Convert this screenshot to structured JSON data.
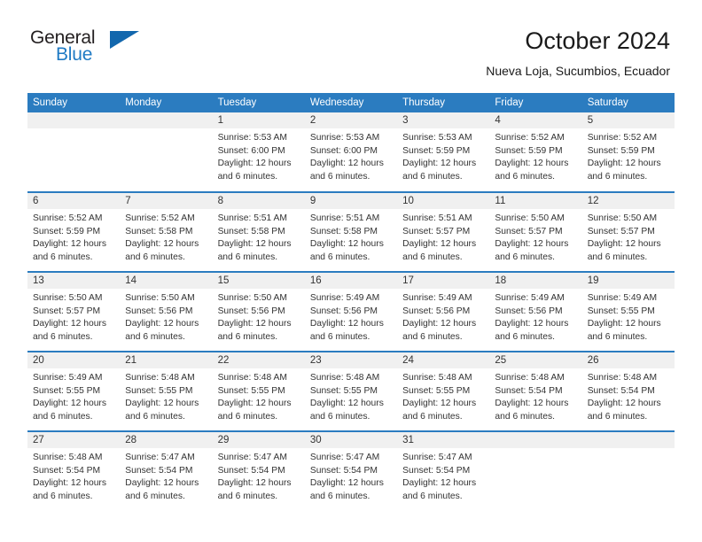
{
  "brand": {
    "name_top": "General",
    "name_bottom": "Blue",
    "accent_color": "#1267ad",
    "text_color": "#231f20"
  },
  "header": {
    "title": "October 2024",
    "subtitle": "Nueva Loja, Sucumbios, Ecuador",
    "header_bg": "#2b7cc0",
    "header_text": "#ffffff"
  },
  "weekdays": [
    "Sunday",
    "Monday",
    "Tuesday",
    "Wednesday",
    "Thursday",
    "Friday",
    "Saturday"
  ],
  "labels": {
    "sunrise_prefix": "Sunrise: ",
    "sunset_prefix": "Sunset: ",
    "daylight_prefix": "Daylight: "
  },
  "weeks": [
    [
      {
        "day": "",
        "sunrise": "",
        "sunset": "",
        "daylight_line1": "",
        "daylight_line2": ""
      },
      {
        "day": "",
        "sunrise": "",
        "sunset": "",
        "daylight_line1": "",
        "daylight_line2": ""
      },
      {
        "day": "1",
        "sunrise": "Sunrise: 5:53 AM",
        "sunset": "Sunset: 6:00 PM",
        "daylight_line1": "Daylight: 12 hours",
        "daylight_line2": "and 6 minutes."
      },
      {
        "day": "2",
        "sunrise": "Sunrise: 5:53 AM",
        "sunset": "Sunset: 6:00 PM",
        "daylight_line1": "Daylight: 12 hours",
        "daylight_line2": "and 6 minutes."
      },
      {
        "day": "3",
        "sunrise": "Sunrise: 5:53 AM",
        "sunset": "Sunset: 5:59 PM",
        "daylight_line1": "Daylight: 12 hours",
        "daylight_line2": "and 6 minutes."
      },
      {
        "day": "4",
        "sunrise": "Sunrise: 5:52 AM",
        "sunset": "Sunset: 5:59 PM",
        "daylight_line1": "Daylight: 12 hours",
        "daylight_line2": "and 6 minutes."
      },
      {
        "day": "5",
        "sunrise": "Sunrise: 5:52 AM",
        "sunset": "Sunset: 5:59 PM",
        "daylight_line1": "Daylight: 12 hours",
        "daylight_line2": "and 6 minutes."
      }
    ],
    [
      {
        "day": "6",
        "sunrise": "Sunrise: 5:52 AM",
        "sunset": "Sunset: 5:59 PM",
        "daylight_line1": "Daylight: 12 hours",
        "daylight_line2": "and 6 minutes."
      },
      {
        "day": "7",
        "sunrise": "Sunrise: 5:52 AM",
        "sunset": "Sunset: 5:58 PM",
        "daylight_line1": "Daylight: 12 hours",
        "daylight_line2": "and 6 minutes."
      },
      {
        "day": "8",
        "sunrise": "Sunrise: 5:51 AM",
        "sunset": "Sunset: 5:58 PM",
        "daylight_line1": "Daylight: 12 hours",
        "daylight_line2": "and 6 minutes."
      },
      {
        "day": "9",
        "sunrise": "Sunrise: 5:51 AM",
        "sunset": "Sunset: 5:58 PM",
        "daylight_line1": "Daylight: 12 hours",
        "daylight_line2": "and 6 minutes."
      },
      {
        "day": "10",
        "sunrise": "Sunrise: 5:51 AM",
        "sunset": "Sunset: 5:57 PM",
        "daylight_line1": "Daylight: 12 hours",
        "daylight_line2": "and 6 minutes."
      },
      {
        "day": "11",
        "sunrise": "Sunrise: 5:50 AM",
        "sunset": "Sunset: 5:57 PM",
        "daylight_line1": "Daylight: 12 hours",
        "daylight_line2": "and 6 minutes."
      },
      {
        "day": "12",
        "sunrise": "Sunrise: 5:50 AM",
        "sunset": "Sunset: 5:57 PM",
        "daylight_line1": "Daylight: 12 hours",
        "daylight_line2": "and 6 minutes."
      }
    ],
    [
      {
        "day": "13",
        "sunrise": "Sunrise: 5:50 AM",
        "sunset": "Sunset: 5:57 PM",
        "daylight_line1": "Daylight: 12 hours",
        "daylight_line2": "and 6 minutes."
      },
      {
        "day": "14",
        "sunrise": "Sunrise: 5:50 AM",
        "sunset": "Sunset: 5:56 PM",
        "daylight_line1": "Daylight: 12 hours",
        "daylight_line2": "and 6 minutes."
      },
      {
        "day": "15",
        "sunrise": "Sunrise: 5:50 AM",
        "sunset": "Sunset: 5:56 PM",
        "daylight_line1": "Daylight: 12 hours",
        "daylight_line2": "and 6 minutes."
      },
      {
        "day": "16",
        "sunrise": "Sunrise: 5:49 AM",
        "sunset": "Sunset: 5:56 PM",
        "daylight_line1": "Daylight: 12 hours",
        "daylight_line2": "and 6 minutes."
      },
      {
        "day": "17",
        "sunrise": "Sunrise: 5:49 AM",
        "sunset": "Sunset: 5:56 PM",
        "daylight_line1": "Daylight: 12 hours",
        "daylight_line2": "and 6 minutes."
      },
      {
        "day": "18",
        "sunrise": "Sunrise: 5:49 AM",
        "sunset": "Sunset: 5:56 PM",
        "daylight_line1": "Daylight: 12 hours",
        "daylight_line2": "and 6 minutes."
      },
      {
        "day": "19",
        "sunrise": "Sunrise: 5:49 AM",
        "sunset": "Sunset: 5:55 PM",
        "daylight_line1": "Daylight: 12 hours",
        "daylight_line2": "and 6 minutes."
      }
    ],
    [
      {
        "day": "20",
        "sunrise": "Sunrise: 5:49 AM",
        "sunset": "Sunset: 5:55 PM",
        "daylight_line1": "Daylight: 12 hours",
        "daylight_line2": "and 6 minutes."
      },
      {
        "day": "21",
        "sunrise": "Sunrise: 5:48 AM",
        "sunset": "Sunset: 5:55 PM",
        "daylight_line1": "Daylight: 12 hours",
        "daylight_line2": "and 6 minutes."
      },
      {
        "day": "22",
        "sunrise": "Sunrise: 5:48 AM",
        "sunset": "Sunset: 5:55 PM",
        "daylight_line1": "Daylight: 12 hours",
        "daylight_line2": "and 6 minutes."
      },
      {
        "day": "23",
        "sunrise": "Sunrise: 5:48 AM",
        "sunset": "Sunset: 5:55 PM",
        "daylight_line1": "Daylight: 12 hours",
        "daylight_line2": "and 6 minutes."
      },
      {
        "day": "24",
        "sunrise": "Sunrise: 5:48 AM",
        "sunset": "Sunset: 5:55 PM",
        "daylight_line1": "Daylight: 12 hours",
        "daylight_line2": "and 6 minutes."
      },
      {
        "day": "25",
        "sunrise": "Sunrise: 5:48 AM",
        "sunset": "Sunset: 5:54 PM",
        "daylight_line1": "Daylight: 12 hours",
        "daylight_line2": "and 6 minutes."
      },
      {
        "day": "26",
        "sunrise": "Sunrise: 5:48 AM",
        "sunset": "Sunset: 5:54 PM",
        "daylight_line1": "Daylight: 12 hours",
        "daylight_line2": "and 6 minutes."
      }
    ],
    [
      {
        "day": "27",
        "sunrise": "Sunrise: 5:48 AM",
        "sunset": "Sunset: 5:54 PM",
        "daylight_line1": "Daylight: 12 hours",
        "daylight_line2": "and 6 minutes."
      },
      {
        "day": "28",
        "sunrise": "Sunrise: 5:47 AM",
        "sunset": "Sunset: 5:54 PM",
        "daylight_line1": "Daylight: 12 hours",
        "daylight_line2": "and 6 minutes."
      },
      {
        "day": "29",
        "sunrise": "Sunrise: 5:47 AM",
        "sunset": "Sunset: 5:54 PM",
        "daylight_line1": "Daylight: 12 hours",
        "daylight_line2": "and 6 minutes."
      },
      {
        "day": "30",
        "sunrise": "Sunrise: 5:47 AM",
        "sunset": "Sunset: 5:54 PM",
        "daylight_line1": "Daylight: 12 hours",
        "daylight_line2": "and 6 minutes."
      },
      {
        "day": "31",
        "sunrise": "Sunrise: 5:47 AM",
        "sunset": "Sunset: 5:54 PM",
        "daylight_line1": "Daylight: 12 hours",
        "daylight_line2": "and 6 minutes."
      },
      {
        "day": "",
        "sunrise": "",
        "sunset": "",
        "daylight_line1": "",
        "daylight_line2": ""
      },
      {
        "day": "",
        "sunrise": "",
        "sunset": "",
        "daylight_line1": "",
        "daylight_line2": ""
      }
    ]
  ]
}
